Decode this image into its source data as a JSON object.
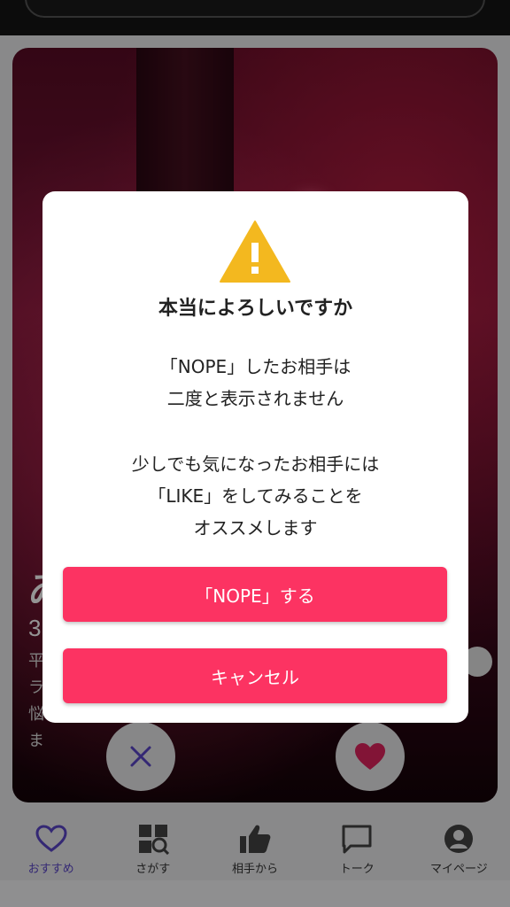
{
  "card": {
    "name_initial": "ゐ",
    "age_partial": "3",
    "bio_lines": [
      "平",
      "ラ",
      "悩",
      "ま"
    ]
  },
  "dialog": {
    "title": "本当によろしいですか",
    "message_line1": "「NOPE」したお相手は",
    "message_line2": "二度と表示されません",
    "message_line3": "少しでも気になったお相手には",
    "message_line4": "「LIKE」をしてみることを",
    "message_line5": "オススメします",
    "confirm_button": "「NOPE」する",
    "cancel_button": "キャンセル",
    "warning_icon": "warning-triangle-icon",
    "warning_color": "#F3B81F",
    "button_color": "#FC3362"
  },
  "actions": {
    "nope_icon": "close-icon",
    "nope_color": "#5b46c8",
    "like_icon": "heart-icon",
    "like_color": "#e0245e"
  },
  "tabbar": {
    "tabs": [
      {
        "label": "おすすめ",
        "icon": "heart-outline-icon",
        "active": true
      },
      {
        "label": "さがす",
        "icon": "grid-search-icon",
        "active": false
      },
      {
        "label": "相手から",
        "icon": "thumbs-up-icon",
        "active": false
      },
      {
        "label": "トーク",
        "icon": "chat-bubble-icon",
        "active": false
      },
      {
        "label": "マイページ",
        "icon": "user-circle-icon",
        "active": false
      }
    ],
    "active_color": "#5b46c8"
  }
}
